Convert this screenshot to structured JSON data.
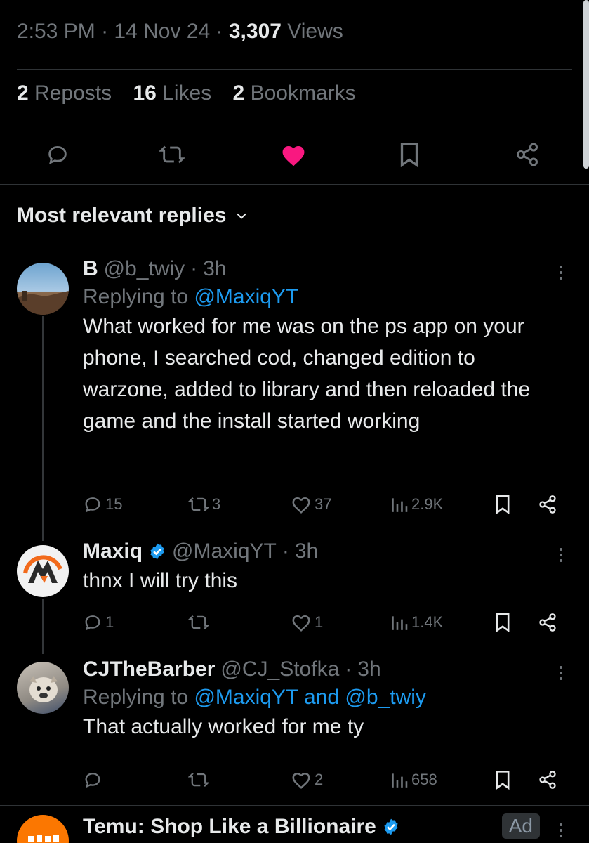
{
  "meta": {
    "time": "2:53 PM",
    "sep": "·",
    "date": "14 Nov 24",
    "views_count": "3,307",
    "views_label": "Views"
  },
  "stats": {
    "reposts_count": "2",
    "reposts_label": "Reposts",
    "likes_count": "16",
    "likes_label": "Likes",
    "bookmarks_count": "2",
    "bookmarks_label": "Bookmarks"
  },
  "action_icons": [
    "reply-icon",
    "repost-icon",
    "like-icon-filled",
    "bookmark-icon",
    "share-icon"
  ],
  "colors": {
    "like": "#f91880",
    "link": "#1d9bf0",
    "verified": "#1d9bf0",
    "muted": "#71767b"
  },
  "replies_header": {
    "label": "Most relevant replies"
  },
  "replies": [
    {
      "name": "B",
      "handle": "@b_twiy",
      "time": "3h",
      "replying_prefix": "Replying to",
      "replying_to": "@MaxiqYT",
      "text": "What worked for me was on the ps app on your phone, I searched cod, changed edition to warzone, added to library and then reloaded the game and the install started working",
      "replies": "15",
      "reposts": "3",
      "likes": "37",
      "views": "2.9K"
    },
    {
      "name": "Maxiq",
      "verified": true,
      "handle": "@MaxiqYT",
      "time": "3h",
      "text": "thnx I will try this",
      "replies": "1",
      "reposts": "",
      "likes": "1",
      "views": "1.4K"
    },
    {
      "name": "CJTheBarber",
      "handle": "@CJ_Stofka",
      "time": "3h",
      "replying_prefix": "Replying to",
      "replying_to": "@MaxiqYT and @b_twiy",
      "text": "That actually worked for me ty",
      "replies": "",
      "reposts": "",
      "likes": "2",
      "views": "658"
    }
  ],
  "ad": {
    "name": "Temu: Shop Like a Billionaire",
    "verified": true,
    "badge": "Ad"
  }
}
